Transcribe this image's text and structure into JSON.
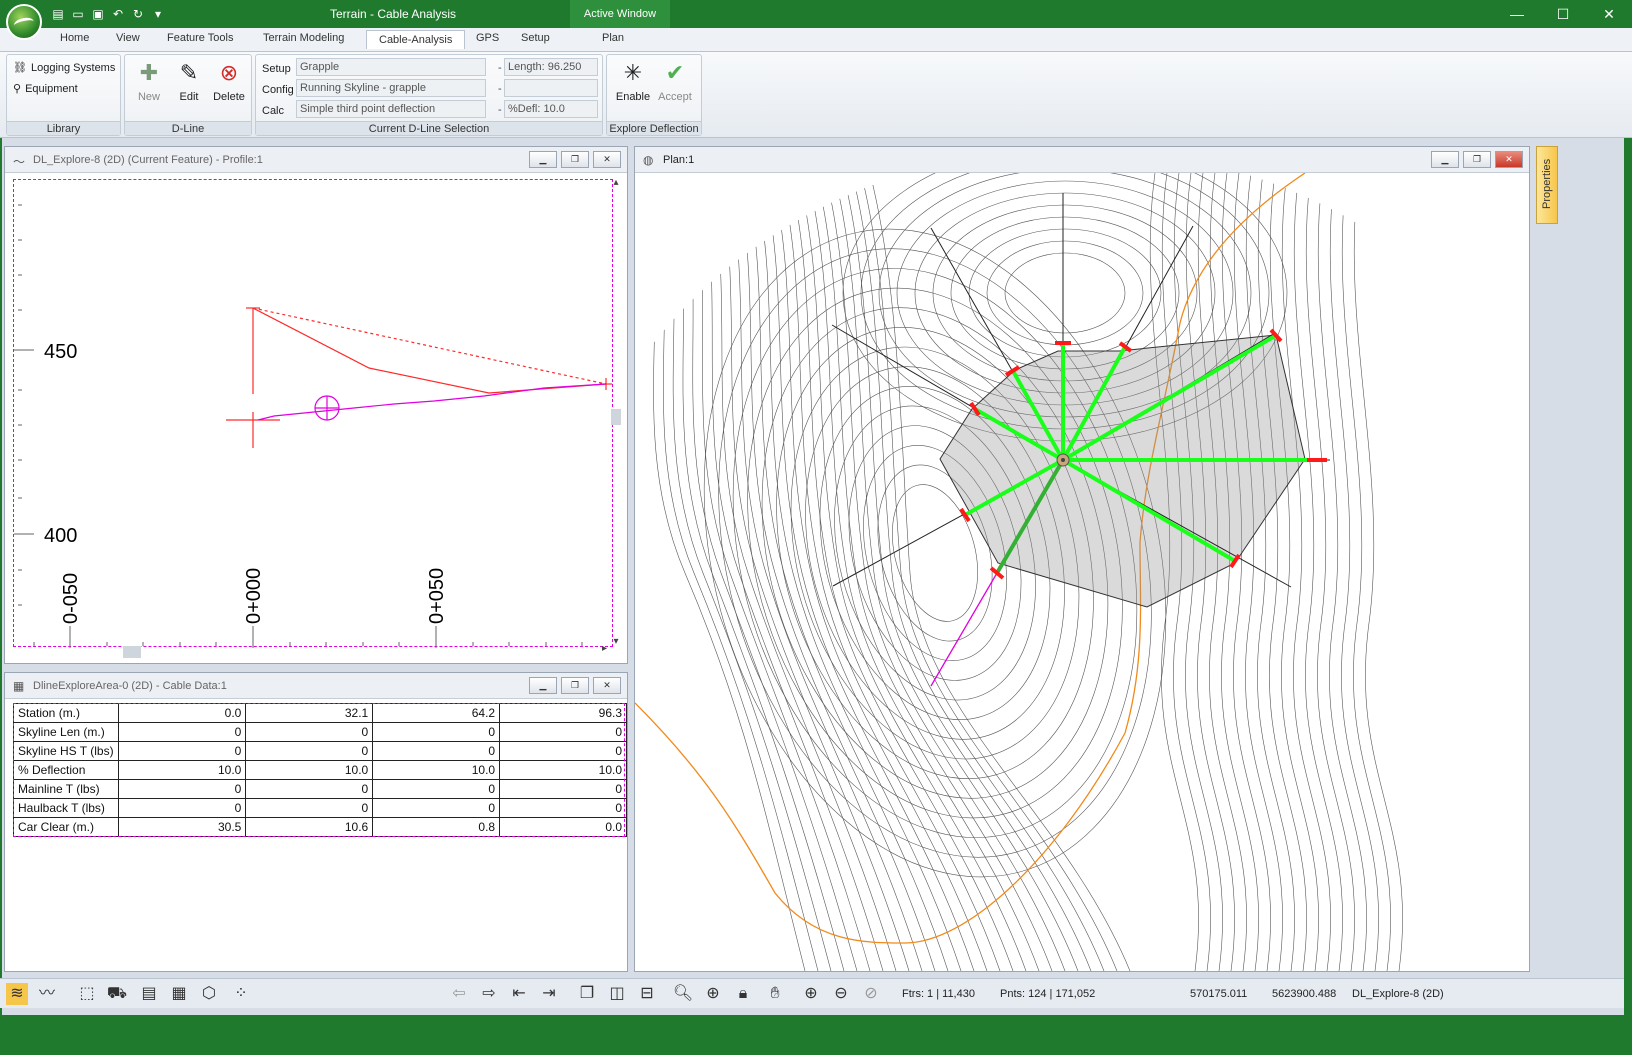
{
  "app": {
    "title": "Terrain - Cable Analysis",
    "active_window_label": "Active Window",
    "window_controls": [
      "—",
      "☐",
      "✕"
    ]
  },
  "tabs": [
    {
      "label": "Home"
    },
    {
      "label": "View"
    },
    {
      "label": "Feature Tools"
    },
    {
      "label": "Terrain Modeling"
    },
    {
      "label": "Cable-Analysis",
      "active": true
    },
    {
      "label": "GPS"
    },
    {
      "label": "Setup"
    },
    {
      "label": "Plan"
    }
  ],
  "ribbon": {
    "library": {
      "label": "Library",
      "logging_systems": "Logging Systems",
      "equipment": "Equipment"
    },
    "dline": {
      "label": "D-Line",
      "new": "New",
      "edit": "Edit",
      "delete": "Delete"
    },
    "selection": {
      "label": "Current D-Line Selection",
      "setup_label": "Setup",
      "setup_value": "Grapple",
      "config_label": "Config",
      "config_value": "Running Skyline - grapple",
      "calc_label": "Calc",
      "calc_value": "Simple third point deflection",
      "length": "Length: 96.250",
      "defl": "%Defl: 10.0",
      "dash": "-"
    },
    "explore": {
      "label": "Explore Deflection",
      "enable": "Enable",
      "accept": "Accept"
    }
  },
  "profile_window": {
    "title": "DL_Explore-8 (2D) (Current Feature) - Profile:1",
    "y_ticks": [
      "450",
      "400"
    ],
    "x_ticks": [
      "0-050",
      "0+000",
      "0+050"
    ]
  },
  "cable_window": {
    "title": "DlineExploreArea-0 (2D) - Cable Data:1",
    "rows": [
      {
        "label": "Station (m.)",
        "values": [
          "0.0",
          "32.1",
          "64.2",
          "96.3"
        ]
      },
      {
        "label": "Skyline Len (m.)",
        "values": [
          "0",
          "0",
          "0",
          "0"
        ]
      },
      {
        "label": "Skyline HS T (lbs)",
        "values": [
          "0",
          "0",
          "0",
          "0"
        ]
      },
      {
        "label": "% Deflection",
        "values": [
          "10.0",
          "10.0",
          "10.0",
          "10.0"
        ]
      },
      {
        "label": "Mainline T (lbs)",
        "values": [
          "0",
          "0",
          "0",
          "0"
        ]
      },
      {
        "label": "Haulback T (lbs)",
        "values": [
          "0",
          "0",
          "0",
          "0"
        ]
      },
      {
        "label": "Car Clear (m.)",
        "values": [
          "30.5",
          "10.6",
          "0.8",
          "0.0"
        ]
      }
    ]
  },
  "plan_window": {
    "title": "Plan:1"
  },
  "properties_tab": "Properties",
  "statusbar": {
    "ftrs": "Ftrs: 1 | 11,430",
    "pnts": "Pnts: 124 | 171,052",
    "x": "570175.011",
    "y": "5623900.488",
    "feature": "DL_Explore-8 (2D)"
  },
  "colors": {
    "brand_green": "#1f7a2e",
    "deflection_green": "#1aff1a",
    "endpoint_red": "#ff0000",
    "road_orange": "#f08a1a",
    "profile_magenta": "#e000e0"
  }
}
